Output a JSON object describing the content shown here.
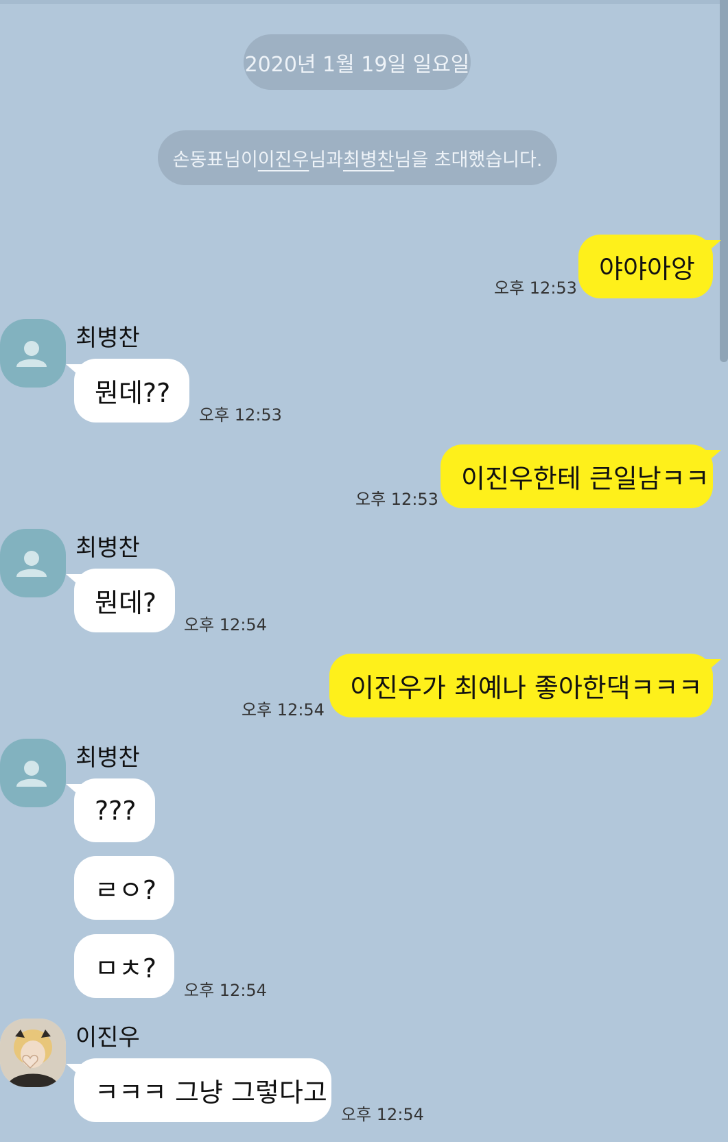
{
  "date_divider": "2020년 1월 19일 일요일",
  "system_notice": {
    "inviter": "손동표님이 ",
    "invitee1": "이진우",
    "mid": "님과 ",
    "invitee2": "최병찬",
    "end": "님을 초대했습니다."
  },
  "messages": [
    {
      "side": "out",
      "text": "야야아앙",
      "time": "오후 12:53"
    },
    {
      "side": "in",
      "sender": "최병찬",
      "text": "뭔데??",
      "time": "오후 12:53"
    },
    {
      "side": "out",
      "text": "이진우한테 큰일남ㅋㅋ",
      "time": "오후 12:53"
    },
    {
      "side": "in",
      "sender": "최병찬",
      "text": "뭔데?",
      "time": "오후 12:54"
    },
    {
      "side": "out",
      "text": "이진우가 최예나 좋아한댁ㅋㅋㅋ",
      "time": "오후 12:54"
    },
    {
      "side": "in",
      "sender": "최병찬",
      "text": "???"
    },
    {
      "side": "in",
      "text": "ㄹㅇ?"
    },
    {
      "side": "in",
      "text": "ㅁㅊ?",
      "time": "오후 12:54"
    },
    {
      "side": "in",
      "sender": "이진우",
      "text": "ㅋㅋㅋ 그냥 그렇다고",
      "time": "오후 12:54"
    }
  ],
  "icons": {
    "default_avatar": "person-icon",
    "photo_avatar": "profile-photo"
  },
  "colors": {
    "background": "#b2c7da",
    "my_bubble": "#fef01b",
    "their_bubble": "#ffffff",
    "avatar": "#82b2bf"
  }
}
